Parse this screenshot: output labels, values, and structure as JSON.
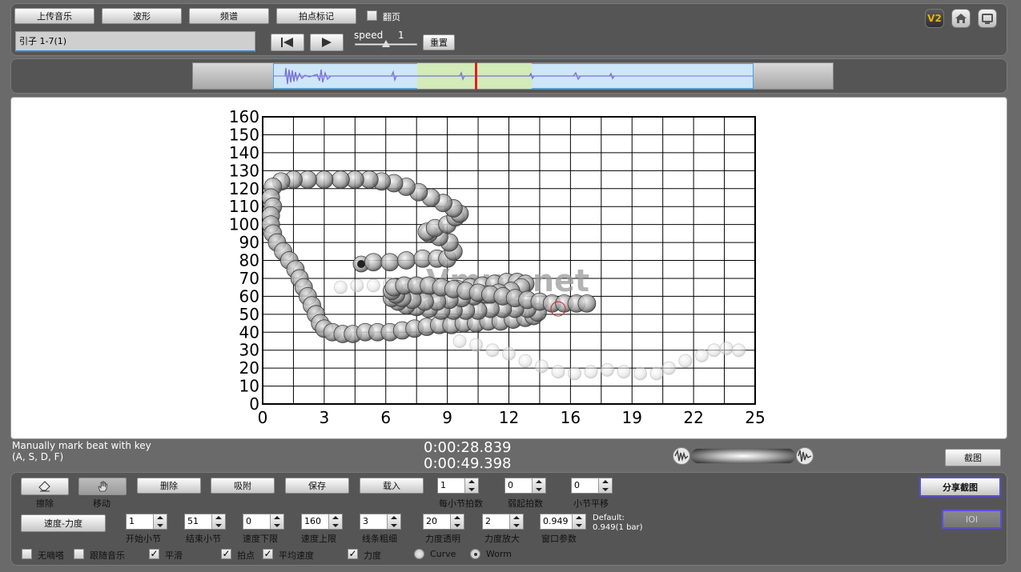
{
  "toolbar": {
    "upload_label": "上传音乐",
    "waveform_label": "波形",
    "spectrum_label": "频谱",
    "beat_mark_label": "拍点标记",
    "page_turn_label": "翻页",
    "track_title": "引子 1-7(1)",
    "speed_label": "speed",
    "speed_value": "1",
    "speed_level": 0.5,
    "reset_label": "重置",
    "v2_badge": "V2"
  },
  "waveform": {
    "selection_start": 0.35,
    "selection_end": 0.53,
    "playhead": 0.44
  },
  "chart_data": {
    "type": "scatter",
    "xlim": [
      0,
      24
    ],
    "ylim": [
      0,
      160
    ],
    "x_ticks": [
      "0",
      "3",
      "6",
      "9",
      "12",
      "16",
      "19",
      "22",
      "25"
    ],
    "y_ticks": [
      "0",
      "10",
      "20",
      "30",
      "40",
      "50",
      "60",
      "70",
      "80",
      "90",
      "100",
      "110",
      "120",
      "130",
      "140",
      "150",
      "160"
    ],
    "watermark": "Vmus.net",
    "grid": true,
    "series": [
      {
        "points": [
          [
            4.8,
            78
          ],
          [
            5.4,
            79
          ],
          [
            6.2,
            79
          ],
          [
            7,
            80
          ],
          [
            7.8,
            81
          ],
          [
            8.5,
            81
          ],
          [
            9,
            81
          ],
          [
            9.3,
            85
          ],
          [
            9.1,
            90
          ],
          [
            8.6,
            93
          ],
          [
            8.1,
            95
          ],
          [
            8,
            96
          ],
          [
            8.4,
            98
          ],
          [
            9,
            100
          ],
          [
            9.4,
            104
          ],
          [
            9.6,
            106
          ],
          [
            9.3,
            109
          ],
          [
            8.8,
            112
          ],
          [
            8.2,
            115
          ],
          [
            7.6,
            118
          ],
          [
            7,
            121
          ],
          [
            6.4,
            123
          ],
          [
            5.8,
            124
          ],
          [
            5.2,
            125
          ],
          [
            4.5,
            125
          ],
          [
            3.8,
            125
          ],
          [
            3,
            125
          ],
          [
            2.2,
            125
          ],
          [
            1.5,
            125
          ],
          [
            0.9,
            124
          ],
          [
            0.5,
            121
          ],
          [
            0.4,
            115
          ],
          [
            0.5,
            110
          ],
          [
            0.4,
            105
          ],
          [
            0.4,
            100
          ],
          [
            0.5,
            95
          ],
          [
            0.7,
            90
          ],
          [
            1,
            85
          ],
          [
            1.3,
            80
          ],
          [
            1.6,
            75
          ],
          [
            1.8,
            70
          ],
          [
            2,
            65
          ],
          [
            2.2,
            60
          ],
          [
            2.4,
            55
          ],
          [
            2.6,
            50
          ],
          [
            2.8,
            45
          ],
          [
            3,
            42
          ],
          [
            3.4,
            40
          ],
          [
            3.9,
            39
          ],
          [
            4.4,
            39
          ],
          [
            5,
            40
          ],
          [
            5.6,
            40
          ],
          [
            6.2,
            40
          ],
          [
            6.8,
            41
          ],
          [
            7.4,
            42
          ],
          [
            8,
            43
          ],
          [
            8.6,
            44
          ],
          [
            9.2,
            44
          ],
          [
            9.8,
            45
          ],
          [
            10.4,
            45
          ],
          [
            11,
            46
          ],
          [
            11.6,
            46
          ],
          [
            12.2,
            47
          ],
          [
            12.8,
            48
          ],
          [
            13.2,
            49
          ],
          [
            13.4,
            51
          ],
          [
            12.9,
            53
          ],
          [
            12.3,
            53
          ],
          [
            11.7,
            53
          ],
          [
            11.1,
            53
          ],
          [
            10.5,
            52
          ],
          [
            9.9,
            52
          ],
          [
            9.3,
            52
          ],
          [
            8.7,
            52
          ],
          [
            8.1,
            53
          ],
          [
            7.5,
            54
          ],
          [
            7,
            55
          ],
          [
            6.6,
            57
          ],
          [
            6.3,
            59
          ],
          [
            6.6,
            61
          ],
          [
            7.1,
            62
          ],
          [
            7.7,
            63
          ],
          [
            8.3,
            64
          ],
          [
            8.9,
            64
          ],
          [
            9.5,
            64
          ],
          [
            10.1,
            65
          ],
          [
            10.7,
            66
          ],
          [
            11.3,
            67
          ],
          [
            11.9,
            68
          ],
          [
            12.4,
            68
          ],
          [
            12.8,
            67
          ],
          [
            12.6,
            65
          ],
          [
            12.1,
            63
          ],
          [
            11.5,
            62
          ],
          [
            10.9,
            61
          ],
          [
            10.3,
            60
          ],
          [
            9.7,
            59
          ],
          [
            9.1,
            58
          ],
          [
            8.5,
            57
          ],
          [
            7.9,
            57
          ],
          [
            7.3,
            58
          ],
          [
            6.8,
            59
          ],
          [
            6.5,
            61
          ],
          [
            6.3,
            63
          ],
          [
            6.4,
            65
          ],
          [
            6.9,
            66
          ],
          [
            7.5,
            66
          ],
          [
            8.1,
            66
          ],
          [
            8.7,
            65
          ],
          [
            9.3,
            64
          ],
          [
            9.9,
            63
          ],
          [
            10.5,
            62
          ],
          [
            11.1,
            61
          ],
          [
            11.7,
            60
          ],
          [
            12.3,
            59
          ],
          [
            12.9,
            58
          ],
          [
            13.5,
            57
          ],
          [
            14.1,
            56
          ],
          [
            14.7,
            56
          ],
          [
            15.3,
            56
          ],
          [
            15.8,
            56
          ]
        ],
        "color": "#555555"
      },
      {
        "points": [
          [
            3.8,
            65
          ],
          [
            4.6,
            66
          ],
          [
            5.4,
            66
          ],
          [
            6.2,
            67
          ],
          [
            7,
            67
          ],
          [
            7.8,
            67
          ],
          [
            9.6,
            35
          ],
          [
            10.4,
            33
          ],
          [
            11.2,
            30
          ],
          [
            12,
            28
          ],
          [
            12.8,
            24
          ],
          [
            13.6,
            21
          ],
          [
            14.4,
            18
          ],
          [
            15.2,
            17
          ],
          [
            16,
            18
          ],
          [
            16.8,
            19
          ],
          [
            17.6,
            18
          ],
          [
            18.4,
            17
          ],
          [
            19.2,
            17
          ],
          [
            19.8,
            20
          ],
          [
            20.6,
            24
          ],
          [
            21.4,
            27
          ],
          [
            22,
            30
          ],
          [
            22.6,
            31
          ],
          [
            23.2,
            30
          ]
        ],
        "color": "#b8b8b8"
      }
    ]
  },
  "status": {
    "hint_line1": "Manually mark beat with key",
    "hint_line2": "(A, S, D, F)",
    "time_current": "0:00:28.839",
    "time_total": "0:00:49.398",
    "screenshot_label": "截图"
  },
  "controls": {
    "erase_label": "擦除",
    "move_label": "移动",
    "delete_label": "删除",
    "snap_label": "吸附",
    "save_label": "保存",
    "load_label": "载入",
    "beats_per_bar_value": "1",
    "beats_per_bar_label": "每小节拍数",
    "weak_beats_value": "0",
    "weak_beats_label": "弱起拍数",
    "bar_shift_value": "0",
    "bar_shift_label": "小节平移",
    "share_label": "分享截图",
    "ioi_label": "IOI",
    "tempo_dyn_label": "速度-力度",
    "start_bar_value": "1",
    "start_bar_label": "开始小节",
    "end_bar_value": "51",
    "end_bar_label": "结束小节",
    "tempo_low_value": "0",
    "tempo_low_label": "速度下限",
    "tempo_high_value": "160",
    "tempo_high_label": "速度上限",
    "line_width_value": "3",
    "line_width_label": "线条粗细",
    "dyn_alpha_value": "20",
    "dyn_alpha_label": "力度透明",
    "dyn_scale_value": "2",
    "dyn_scale_label": "力度放大",
    "window_param_value": "0.949",
    "window_param_label": "窗口参数",
    "default_line1": "Default:",
    "default_line2": "0.949(1 bar)",
    "no_click_label": "无嘀嗒",
    "follow_music_label": "跟随音乐",
    "smooth_label": "平滑",
    "beat_point_label": "拍点",
    "avg_tempo_label": "平均速度",
    "dynamics_label": "力度",
    "curve_label": "Curve",
    "worm_label": "Worm"
  }
}
